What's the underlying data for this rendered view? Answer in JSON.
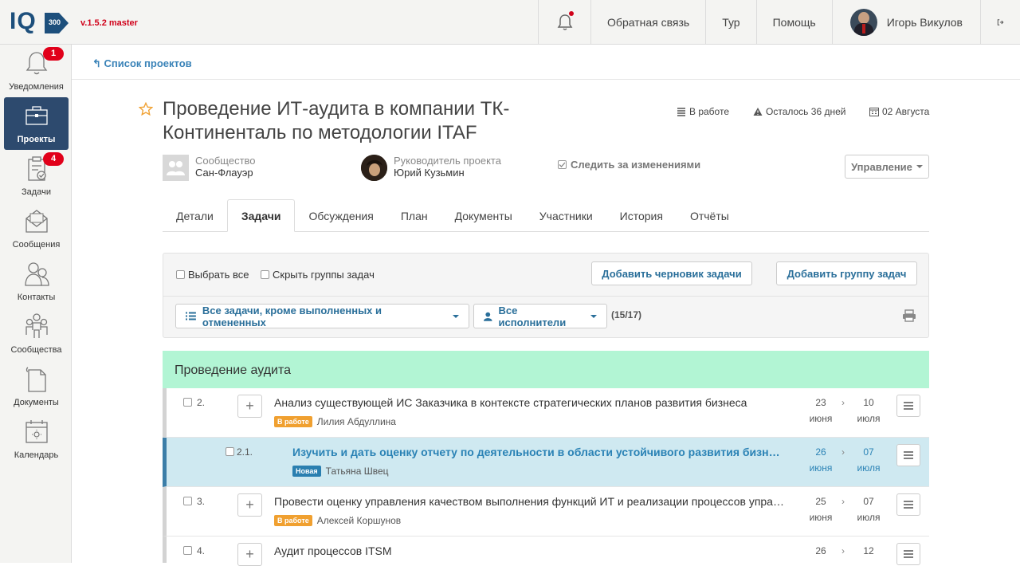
{
  "app": {
    "logo": "IQ",
    "logo_sub": "300",
    "version": "v.1.5.2 master"
  },
  "topnav": {
    "feedback": "Обратная связь",
    "tour": "Тур",
    "help": "Помощь",
    "user_name": "Игорь Викулов"
  },
  "sidebar": {
    "items": [
      {
        "label": "Уведомления",
        "icon": "bell-icon",
        "badge": "1"
      },
      {
        "label": "Проекты",
        "icon": "briefcase-icon"
      },
      {
        "label": "Задачи",
        "icon": "clipboard-icon",
        "badge": "4"
      },
      {
        "label": "Сообщения",
        "icon": "envelope-icon"
      },
      {
        "label": "Контакты",
        "icon": "contacts-icon"
      },
      {
        "label": "Сообщества",
        "icon": "community-icon"
      },
      {
        "label": "Документы",
        "icon": "document-icon"
      },
      {
        "label": "Календарь",
        "icon": "calendar-icon"
      }
    ]
  },
  "breadcrumb": {
    "back_label": "Список проектов"
  },
  "project": {
    "title": "Проведение ИТ-аудита в компании ТК-Континенталь по методологии ITAF",
    "status": "В работе",
    "remaining": "Осталось 36 дней",
    "deadline": "02 Августа",
    "community_label": "Сообщество",
    "community_value": "Сан-Флауэр",
    "manager_label": "Руководитель проекта",
    "manager_value": "Юрий Кузьмин",
    "follow_label": "Следить за изменениями",
    "manage_label": "Управление"
  },
  "tabs": [
    {
      "label": "Детали"
    },
    {
      "label": "Задачи",
      "active": true
    },
    {
      "label": "Обсуждения"
    },
    {
      "label": "План"
    },
    {
      "label": "Документы"
    },
    {
      "label": "Участники"
    },
    {
      "label": "История"
    },
    {
      "label": "Отчёты"
    }
  ],
  "toolbar": {
    "select_all": "Выбрать все",
    "hide_groups": "Скрыть группы задач",
    "add_draft": "Добавить черновик задачи",
    "add_group": "Добавить группу задач",
    "filter_tasks": "Все задачи, кроме выполненных и отмененных",
    "filter_assignees": "Все исполнители",
    "count": "(15/17)"
  },
  "task_group": {
    "title": "Проведение аудита"
  },
  "tasks": [
    {
      "num": "2.",
      "name": "Анализ существующей ИС Заказчика в контексте стратегических планов развития бизнеса",
      "status": "В работе",
      "status_color": "#f0a030",
      "assignee": "Лилия Абдуллина",
      "start_day": "23",
      "start_month": "июня",
      "end_day": "10",
      "end_month": "июля"
    },
    {
      "num": "2.1.",
      "name": "Изучить и дать оценку отчету по деятельности в области устойчивого развития бизнеса",
      "status": "Новая",
      "status_color": "#2a7fb0",
      "assignee": "Татьяна Швец",
      "start_day": "26",
      "start_month": "июня",
      "end_day": "07",
      "end_month": "июля"
    },
    {
      "num": "3.",
      "name": "Провести оценку управления качеством выполнения функций ИТ и реализации процессов управления ИТ",
      "status": "В работе",
      "status_color": "#f0a030",
      "assignee": "Алексей Коршунов",
      "start_day": "25",
      "start_month": "июня",
      "end_day": "07",
      "end_month": "июля"
    },
    {
      "num": "4.",
      "name": "Аудит процессов ITSM",
      "start_day": "26",
      "end_day": "12"
    }
  ]
}
